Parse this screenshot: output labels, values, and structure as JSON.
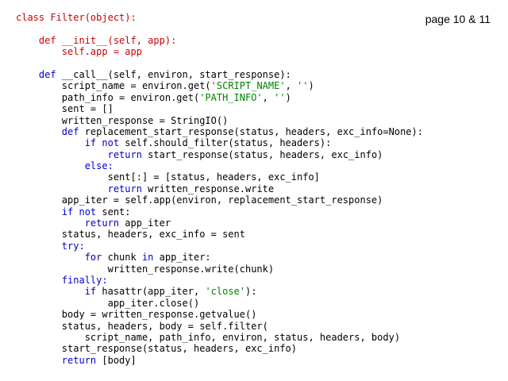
{
  "header": {
    "page_reference": "page 10 & 11"
  },
  "colors": {
    "default": "#000000",
    "definition": "#cc0000",
    "keyword": "#0000cc",
    "string": "#008000"
  },
  "code": {
    "lines": [
      [
        {
          "t": "class Filter(object):",
          "c": "red"
        }
      ],
      [],
      [
        {
          "t": "    def __init__(self, app):",
          "c": "red"
        }
      ],
      [
        {
          "t": "        self.app = app",
          "c": "red"
        }
      ],
      [],
      [
        {
          "t": "    def",
          "c": "blue"
        },
        {
          "t": " __call__(self, environ, start_response):",
          "c": "black"
        }
      ],
      [
        {
          "t": "        script_name = environ.get(",
          "c": "black"
        },
        {
          "t": "'SCRIPT_NAME'",
          "c": "green"
        },
        {
          "t": ", ",
          "c": "black"
        },
        {
          "t": "''",
          "c": "green"
        },
        {
          "t": ")",
          "c": "black"
        }
      ],
      [
        {
          "t": "        path_info = environ.get(",
          "c": "black"
        },
        {
          "t": "'PATH_INFO'",
          "c": "green"
        },
        {
          "t": ", ",
          "c": "black"
        },
        {
          "t": "''",
          "c": "green"
        },
        {
          "t": ")",
          "c": "black"
        }
      ],
      [
        {
          "t": "        sent = []",
          "c": "black"
        }
      ],
      [
        {
          "t": "        written_response = StringIO()",
          "c": "black"
        }
      ],
      [
        {
          "t": "        def",
          "c": "blue"
        },
        {
          "t": " replacement_start_response(status, headers, exc_info=None):",
          "c": "black"
        }
      ],
      [
        {
          "t": "            if not",
          "c": "blue"
        },
        {
          "t": " self.should_filter(status, headers):",
          "c": "black"
        }
      ],
      [
        {
          "t": "                return",
          "c": "blue"
        },
        {
          "t": " start_response(status, headers, exc_info)",
          "c": "black"
        }
      ],
      [
        {
          "t": "            else:",
          "c": "blue"
        }
      ],
      [
        {
          "t": "                sent[:] = [status, headers, exc_info]",
          "c": "black"
        }
      ],
      [
        {
          "t": "                return",
          "c": "blue"
        },
        {
          "t": " written_response.write",
          "c": "black"
        }
      ],
      [
        {
          "t": "        app_iter = self.app(environ, replacement_start_response)",
          "c": "black"
        }
      ],
      [
        {
          "t": "        if not",
          "c": "blue"
        },
        {
          "t": " sent:",
          "c": "black"
        }
      ],
      [
        {
          "t": "            return",
          "c": "blue"
        },
        {
          "t": " app_iter",
          "c": "black"
        }
      ],
      [
        {
          "t": "        status, headers, exc_info = sent",
          "c": "black"
        }
      ],
      [
        {
          "t": "        try:",
          "c": "blue"
        }
      ],
      [
        {
          "t": "            for",
          "c": "blue"
        },
        {
          "t": " chunk ",
          "c": "black"
        },
        {
          "t": "in",
          "c": "blue"
        },
        {
          "t": " app_iter:",
          "c": "black"
        }
      ],
      [
        {
          "t": "                written_response.write(chunk)",
          "c": "black"
        }
      ],
      [
        {
          "t": "        finally:",
          "c": "blue"
        }
      ],
      [
        {
          "t": "            if",
          "c": "blue"
        },
        {
          "t": " hasattr(app_iter, ",
          "c": "black"
        },
        {
          "t": "'close'",
          "c": "green"
        },
        {
          "t": "):",
          "c": "black"
        }
      ],
      [
        {
          "t": "                app_iter.close()",
          "c": "black"
        }
      ],
      [
        {
          "t": "        body = written_response.getvalue()",
          "c": "black"
        }
      ],
      [
        {
          "t": "        status, headers, body = self.filter(",
          "c": "black"
        }
      ],
      [
        {
          "t": "            script_name, path_info, environ, status, headers, body)",
          "c": "black"
        }
      ],
      [
        {
          "t": "        start_response(status, headers, exc_info)",
          "c": "black"
        }
      ],
      [
        {
          "t": "        return",
          "c": "blue"
        },
        {
          "t": " [body]",
          "c": "black"
        }
      ]
    ]
  }
}
